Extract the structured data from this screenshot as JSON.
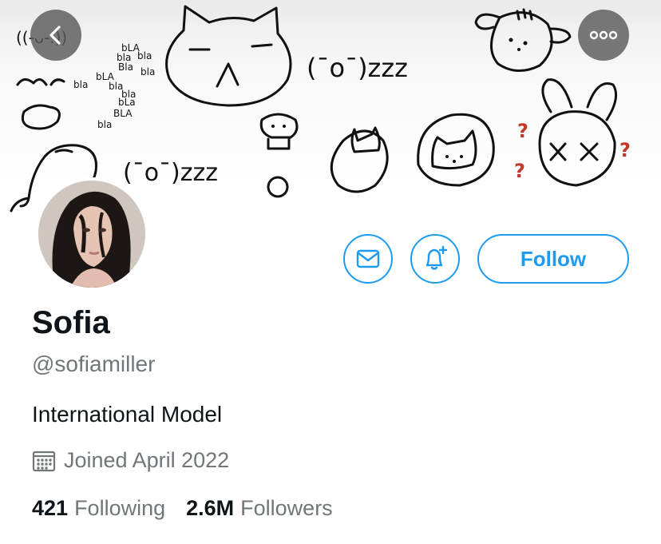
{
  "banner": {
    "doodle_text": {
      "bla_words": [
        "bLA",
        "bla",
        "bla",
        "bla",
        "Bla",
        "bla",
        "bLA",
        "bla",
        "bla",
        "bLa",
        "BLA",
        "bla"
      ],
      "kaomoji_small": "((-ᴗ-.))",
      "kaomoji_sleep_top": "(¯o¯)zzz",
      "kaomoji_sleep_bottom": "(¯o¯)zzz",
      "question_marks": [
        "?",
        "?",
        "?"
      ]
    }
  },
  "nav": {
    "back_icon": "chevron-left-icon",
    "more_icon": "more-horizontal-icon"
  },
  "actions": {
    "message_icon": "mail-icon",
    "notify_icon": "bell-plus-icon",
    "follow_label": "Follow",
    "accent_color": "#1d9bf0"
  },
  "profile": {
    "name": "Sofia",
    "handle": "@sofiamiller",
    "bio": "International Model",
    "joined": "Joined April 2022",
    "following_count": "421",
    "following_label": "Following",
    "followers_count": "2.6M",
    "followers_label": "Followers"
  }
}
